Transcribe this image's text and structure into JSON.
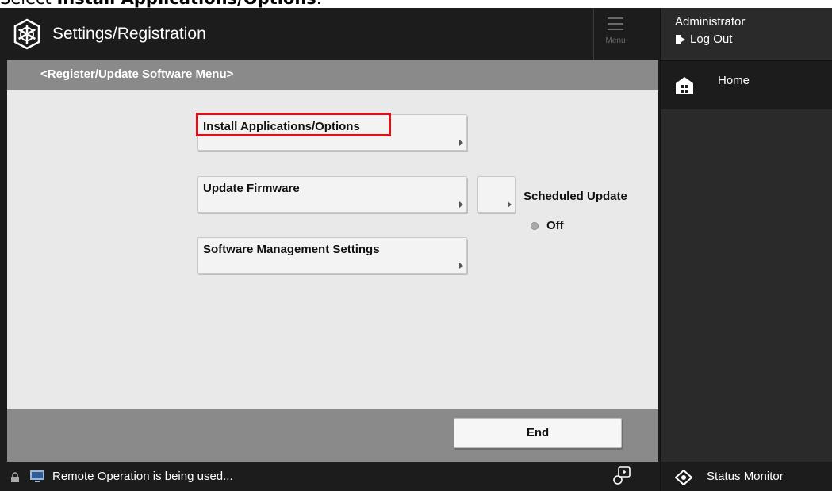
{
  "caption": {
    "prefix": "Select ",
    "bold": "Install Applications/Options",
    "suffix": "."
  },
  "titlebar": {
    "title": "Settings/Registration",
    "menu_label": "Menu"
  },
  "user": {
    "name": "Administrator",
    "logout_label": "Log Out"
  },
  "nav": {
    "home_label": "Home",
    "status_monitor_label": "Status Monitor"
  },
  "main": {
    "breadcrumb": "<Register/Update Software Menu>",
    "buttons": {
      "install": "Install Applications/Options",
      "firmware": "Update Firmware",
      "software": "Software Management Settings"
    },
    "scheduled_update": {
      "label": "Scheduled Update",
      "status": "Off"
    },
    "end_label": "End"
  },
  "statusbar": {
    "text": "Remote Operation is being used..."
  },
  "colors": {
    "highlight": "#e0101a",
    "dark": "#1c1c1c",
    "gray_bar": "#8a8a8a"
  }
}
